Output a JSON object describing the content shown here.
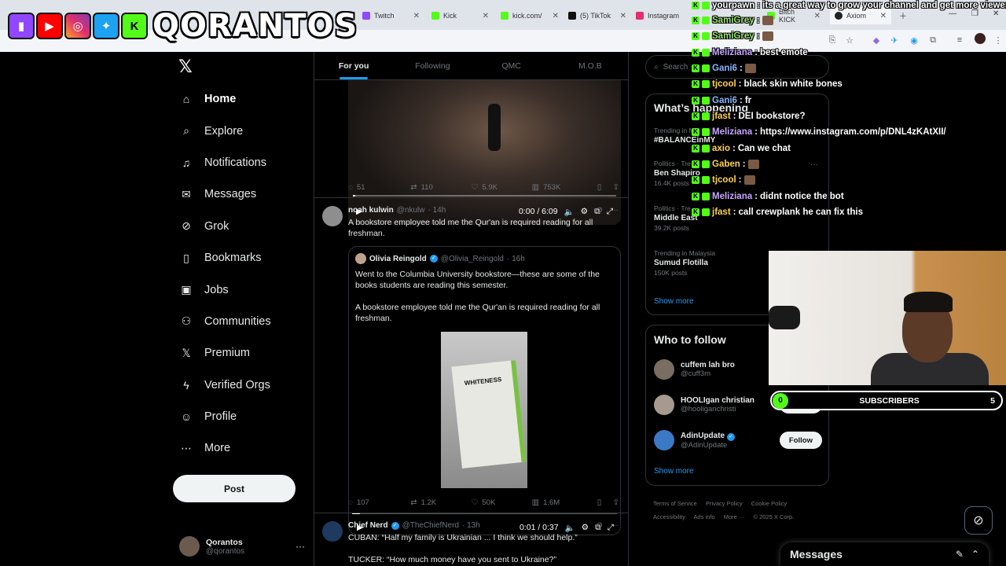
{
  "browser": {
    "tabs": [
      {
        "label": "Twitch",
        "color": "#9146ff"
      },
      {
        "label": "Kick",
        "color": "#53fc18"
      },
      {
        "label": "kick.com/",
        "color": "#53fc18"
      },
      {
        "label": "(5) TikTok",
        "color": "#111111"
      },
      {
        "label": "Instagram",
        "color": "#e1306c"
      },
      {
        "label": "Bitch KICK",
        "color": "#53fc18"
      },
      {
        "label": "Axiom",
        "color": "#222222"
      }
    ]
  },
  "overlay": {
    "brand_name": "QORANTOS",
    "platforms": [
      "twitch",
      "youtube",
      "instagram",
      "twitter",
      "kick"
    ],
    "chat": [
      {
        "user": "yourpawn",
        "color": "#ffffff",
        "text": "its a great way to grow your channel and get more viewers"
      },
      {
        "user": "SamiGrey",
        "color": "#9ae66e",
        "text": ""
      },
      {
        "user": "SamiGrey",
        "color": "#9ae66e",
        "text": ""
      },
      {
        "user": "Meliziana",
        "color": "#c7a6ff",
        "text": "best emote"
      },
      {
        "user": "Gani6",
        "color": "#8ab4ff",
        "text": ""
      },
      {
        "user": "tjcool",
        "color": "#ffd24d",
        "text": "black skin white bones"
      },
      {
        "user": "Gani6",
        "color": "#8ab4ff",
        "text": "fr"
      },
      {
        "user": "jfast",
        "color": "#ffd24d",
        "text": "DEI bookstore?"
      },
      {
        "user": "Meliziana",
        "color": "#c7a6ff",
        "text": "https://www.instagram.com/p/DNL4zKAtXII/"
      },
      {
        "user": "axio",
        "color": "#ffd24d",
        "text": "Can we chat"
      },
      {
        "user": "Gaben",
        "color": "#ffd24d",
        "text": ""
      },
      {
        "user": "tjcool",
        "color": "#ffd24d",
        "text": ""
      },
      {
        "user": "Meliziana",
        "color": "#c7a6ff",
        "text": "didnt notice the bot"
      },
      {
        "user": "jfast",
        "color": "#ffd24d",
        "text": "call crewplank he can fix this"
      }
    ],
    "subscribers": {
      "label": "SUBSCRIBERS",
      "current": "0",
      "goal": "5"
    }
  },
  "nav": {
    "items": [
      {
        "label": "Home",
        "icon": "home-icon",
        "glyph": "⌂"
      },
      {
        "label": "Explore",
        "icon": "search-icon",
        "glyph": "⌕"
      },
      {
        "label": "Notifications",
        "icon": "bell-icon",
        "glyph": "♫"
      },
      {
        "label": "Messages",
        "icon": "envelope-icon",
        "glyph": "✉"
      },
      {
        "label": "Grok",
        "icon": "grok-icon",
        "glyph": "⊘"
      },
      {
        "label": "Bookmarks",
        "icon": "bookmark-icon",
        "glyph": "▯"
      },
      {
        "label": "Jobs",
        "icon": "briefcase-icon",
        "glyph": "▣"
      },
      {
        "label": "Communities",
        "icon": "communities-icon",
        "glyph": "⚇"
      },
      {
        "label": "Premium",
        "icon": "x-premium-icon",
        "glyph": "𝕏"
      },
      {
        "label": "Verified Orgs",
        "icon": "lightning-icon",
        "glyph": "ϟ"
      },
      {
        "label": "Profile",
        "icon": "person-icon",
        "glyph": "☺"
      },
      {
        "label": "More",
        "icon": "more-circle-icon",
        "glyph": "⋯"
      }
    ],
    "post_label": "Post",
    "me": {
      "name": "Qorantos",
      "handle": "@qorantos"
    }
  },
  "feed": {
    "tabs": [
      "For you",
      "Following",
      "QMC",
      "M.O.B"
    ],
    "tweet1": {
      "video_time": "0:00 / 6:09",
      "stats": {
        "replies": "51",
        "reposts": "110",
        "likes": "5.9K",
        "views": "753K"
      }
    },
    "tweet2": {
      "name": "noah kulwin",
      "handle": "@nkulw",
      "time": "· 14h",
      "text": "A bookstore employee told me the Qur'an is required reading for all freshman.",
      "quote": {
        "name": "Olivia Reingold",
        "handle": "@Olivia_Reingold",
        "time": "· 16h",
        "text1": "Went to the Columbia University bookstore—these are some of the books students are reading this semester.",
        "text2": "A bookstore employee told me the Qur'an is required reading for all freshman.",
        "book_title": "WHITENESS",
        "video_time": "0:01 / 0:37"
      },
      "stats": {
        "replies": "107",
        "reposts": "1.2K",
        "likes": "50K",
        "views": "1.6M"
      }
    },
    "tweet3": {
      "name": "Chief Nerd",
      "handle": "@TheChiefNerd",
      "time": "· 13h",
      "line1": "CUBAN: “Half my family is Ukrainian ... I think we should help.”",
      "line2": "TUCKER: “How much money have you sent to Ukraine?”"
    }
  },
  "sidebar": {
    "search_placeholder": "Search",
    "happening_title": "What’s happening",
    "trends": [
      {
        "meta": "Trending in M",
        "name": "#BALANCEinMY",
        "count": ""
      },
      {
        "meta": "Politics · Tre",
        "name": "Ben Shapiro",
        "count": "16.4K posts"
      },
      {
        "meta": "Politics · Tre",
        "name": "Middle East",
        "count": "39.2K posts"
      },
      {
        "meta": "Trending in Malaysia",
        "name": "Sumud Flotilla",
        "count": "150K posts"
      }
    ],
    "show_more": "Show more",
    "wtf_title": "Who to follow",
    "who_to_follow": [
      {
        "name": "cuffem lah bro",
        "handle": "@cuff3m",
        "avatar": "#7a6e63",
        "button": ""
      },
      {
        "name": "HOOLIgan christian",
        "handle": "@hooliganchristi",
        "avatar": "#a59a8d",
        "button": "Follow"
      },
      {
        "name": "AdinUpdate",
        "handle": "@AdinUpdate",
        "avatar": "#3b79c4",
        "button": "Follow"
      }
    ],
    "footer": [
      "Terms of Service",
      "Privacy Policy",
      "Cookie Policy",
      "Accessibility",
      "Ads info",
      "More ···",
      "© 2025 X Corp."
    ],
    "messages_label": "Messages"
  }
}
